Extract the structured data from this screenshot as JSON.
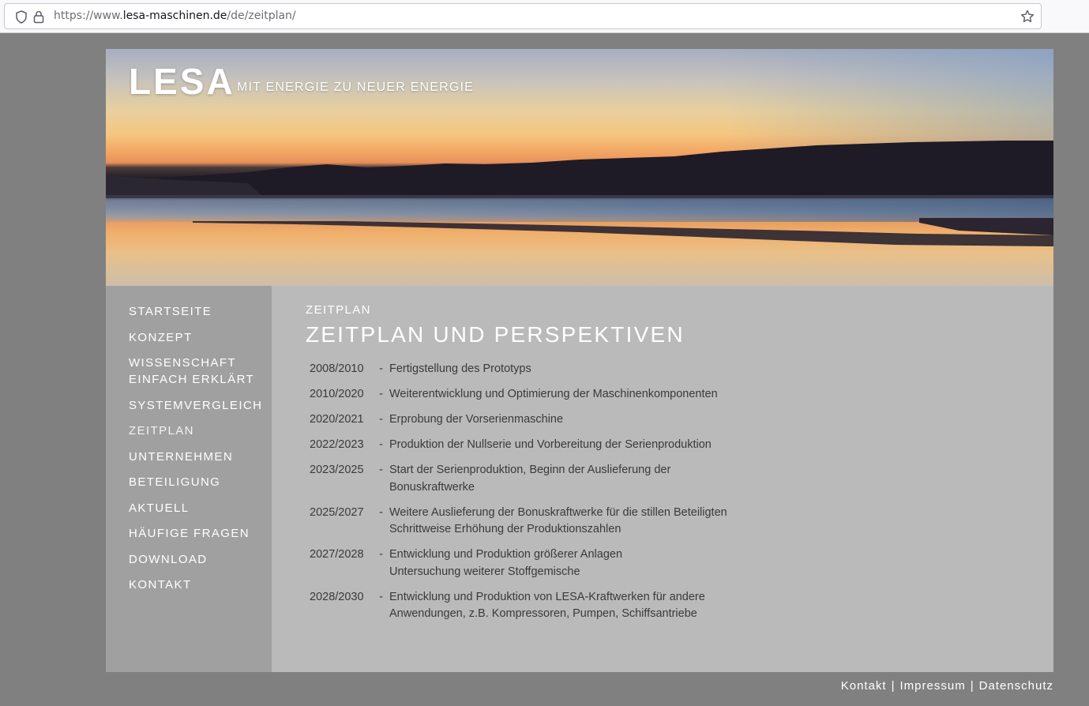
{
  "browser": {
    "url_prefix": "https://www.",
    "url_host": "lesa-maschinen.de",
    "url_path": "/de/zeitplan/"
  },
  "header": {
    "logo": "LESA",
    "tagline": "MIT ENERGIE ZU NEUER ENERGIE"
  },
  "nav": {
    "items": [
      {
        "label": "STARTSEITE"
      },
      {
        "label": "KONZEPT"
      },
      {
        "label": "WISSENSCHAFT EINFACH ERKLÄRT"
      },
      {
        "label": "SYSTEMVERGLEICH"
      },
      {
        "label": "ZEITPLAN"
      },
      {
        "label": "UNTERNEHMEN"
      },
      {
        "label": "BETEILIGUNG"
      },
      {
        "label": "AKTUELL"
      },
      {
        "label": "HÄUFIGE FRAGEN"
      },
      {
        "label": "DOWNLOAD"
      },
      {
        "label": "KONTAKT"
      }
    ],
    "active": "ZEITPLAN"
  },
  "content": {
    "breadcrumb": "ZEITPLAN",
    "title": "ZEITPLAN UND PERSPEKTIVEN",
    "dash": "-",
    "timeline": [
      {
        "year": "2008/2010",
        "lines": [
          "Fertigstellung des Prototyps"
        ]
      },
      {
        "year": "2010/2020",
        "lines": [
          "Weiterentwicklung und Optimierung der Maschinenkomponenten"
        ]
      },
      {
        "year": "2020/2021",
        "lines": [
          "Erprobung der Vorserienmaschine"
        ]
      },
      {
        "year": "2022/2023",
        "lines": [
          "Produktion der Nullserie und Vorbereitung der Serienproduktion"
        ]
      },
      {
        "year": "2023/2025",
        "lines": [
          "Start der Serienproduktion, Beginn der Auslieferung der",
          "Bonuskraftwerke"
        ]
      },
      {
        "year": "2025/2027",
        "lines": [
          "Weitere Auslieferung der Bonuskraftwerke für die stillen Beteiligten",
          "Schrittweise Erhöhung der Produktionszahlen"
        ]
      },
      {
        "year": "2027/2028",
        "lines": [
          "Entwicklung und Produktion größerer Anlagen",
          "Untersuchung weiterer Stoffgemische"
        ]
      },
      {
        "year": "2028/2030",
        "lines": [
          "Entwicklung und Produktion von LESA-Kraftwerken für andere",
          "Anwendungen, z.B. Kompressoren, Pumpen, Schiffsantriebe"
        ]
      }
    ]
  },
  "footer": {
    "links": [
      "Kontakt",
      "Impressum",
      "Datenschutz"
    ],
    "separator": "|"
  }
}
